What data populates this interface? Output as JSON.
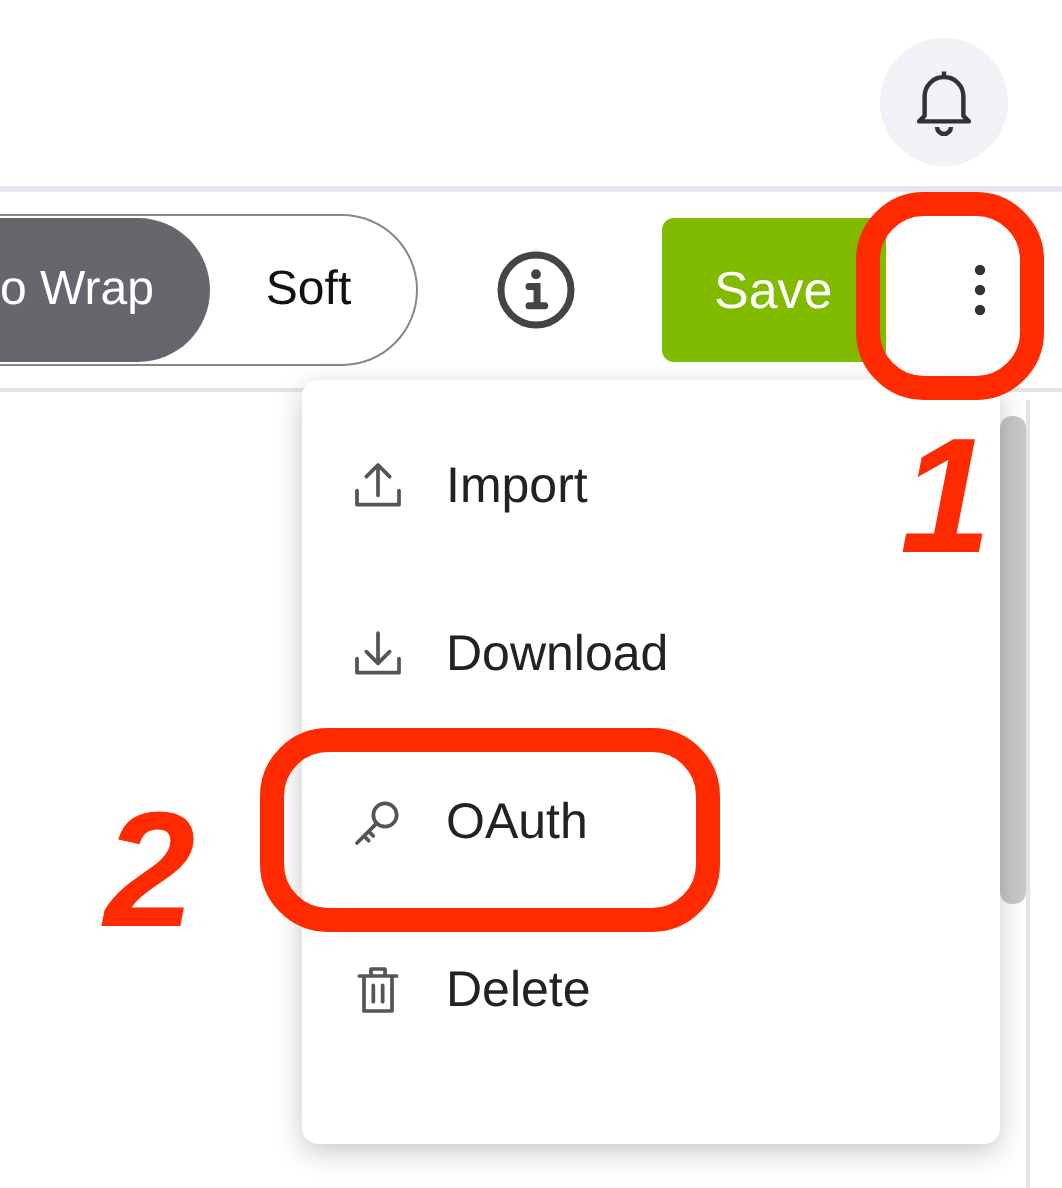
{
  "toolbar": {
    "wrap_options": [
      {
        "label": "o Wrap",
        "selected": true
      },
      {
        "label": "Soft",
        "selected": false
      }
    ],
    "save_label": "Save"
  },
  "menu": {
    "items": [
      {
        "kind": "import",
        "label": "Import"
      },
      {
        "kind": "download",
        "label": "Download"
      },
      {
        "kind": "key",
        "label": "OAuth"
      },
      {
        "kind": "delete",
        "label": "Delete"
      }
    ]
  },
  "annotations": [
    {
      "kind": "menu-button",
      "number": "1"
    },
    {
      "kind": "menu-item",
      "number": "2"
    }
  ]
}
